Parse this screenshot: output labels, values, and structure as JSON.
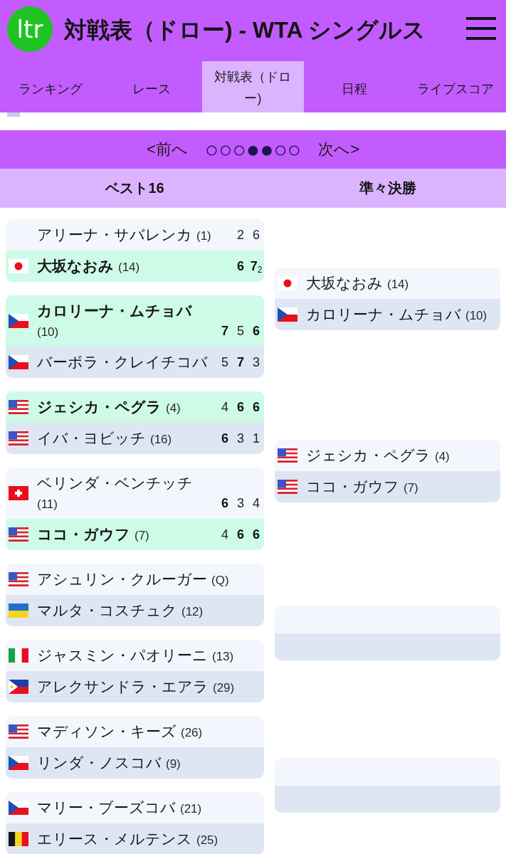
{
  "header": {
    "logo": "ltr",
    "title": "対戦表（ドロー) - WTA シングルス"
  },
  "tabs": [
    {
      "label": "ランキング",
      "selected": false
    },
    {
      "label": "レース",
      "selected": false
    },
    {
      "label": "対戦表（ドロー)",
      "selected": true
    },
    {
      "label": "日程",
      "selected": false
    },
    {
      "label": "ライブスコア",
      "selected": false
    }
  ],
  "pager": {
    "prev": "<前へ",
    "dots": "○○○●●○○",
    "next": "次へ>"
  },
  "rounds": [
    {
      "title": "ベスト16",
      "matches": [
        {
          "kind": "match",
          "players": [
            {
              "name": "アリーナ・サバレンカ",
              "seed": "(1)",
              "winner": false,
              "scores": [
                {
                  "games": "2",
                  "won": false
                },
                {
                  "games": "6",
                  "won": false
                }
              ]
            },
            {
              "flag": {
                "kind": "jp"
              },
              "name": "大坂なおみ",
              "seed": "(14)",
              "winner": true,
              "scores": [
                {
                  "games": "6",
                  "won": true
                },
                {
                  "games": "7",
                  "won": true,
                  "tiebreak": "2"
                }
              ]
            }
          ]
        },
        {
          "kind": "match",
          "players": [
            {
              "flag": {
                "kind": "cz"
              },
              "name": "カロリーナ・ムチョバ",
              "seed": "(10)",
              "winner": true,
              "scores": [
                {
                  "games": "7",
                  "won": true
                },
                {
                  "games": "5",
                  "won": false
                },
                {
                  "games": "6",
                  "won": true
                }
              ]
            },
            {
              "flag": {
                "kind": "cz"
              },
              "name": "バーボラ・クレイチコバ",
              "winner": false,
              "scores": [
                {
                  "games": "5",
                  "won": false
                },
                {
                  "games": "7",
                  "won": true
                },
                {
                  "games": "3",
                  "won": false
                }
              ]
            }
          ]
        },
        {
          "kind": "match",
          "players": [
            {
              "flag": {
                "kind": "us"
              },
              "name": "ジェシカ・ペグラ",
              "seed": "(4)",
              "winner": true,
              "scores": [
                {
                  "games": "4",
                  "won": false
                },
                {
                  "games": "6",
                  "won": true
                },
                {
                  "games": "6",
                  "won": true
                }
              ]
            },
            {
              "flag": {
                "kind": "us"
              },
              "name": "イバ・ヨビッチ",
              "seed": "(16)",
              "winner": false,
              "scores": [
                {
                  "games": "6",
                  "won": true
                },
                {
                  "games": "3",
                  "won": false
                },
                {
                  "games": "1",
                  "won": false
                }
              ]
            }
          ]
        },
        {
          "kind": "match",
          "players": [
            {
              "flag": {
                "kind": "ch"
              },
              "name": "ベリンダ・ベンチッチ",
              "seed": "(11)",
              "winner": false,
              "scores": [
                {
                  "games": "6",
                  "won": true
                },
                {
                  "games": "3",
                  "won": false
                },
                {
                  "games": "4",
                  "won": false
                }
              ]
            },
            {
              "flag": {
                "kind": "us"
              },
              "name": "ココ・ガウフ",
              "seed": "(7)",
              "winner": true,
              "scores": [
                {
                  "games": "4",
                  "won": false
                },
                {
                  "games": "6",
                  "won": true
                },
                {
                  "games": "6",
                  "won": true
                }
              ]
            }
          ]
        },
        {
          "kind": "match",
          "players": [
            {
              "flag": {
                "kind": "us"
              },
              "name": "アシュリン・クルーガー",
              "seed": "(Q)",
              "winner": false
            },
            {
              "flag": {
                "kind": "ua"
              },
              "name": "マルタ・コスチュク",
              "seed": "(12)",
              "winner": false
            }
          ]
        },
        {
          "kind": "match",
          "players": [
            {
              "flag": {
                "kind": "it"
              },
              "name": "ジャスミン・パオリーニ",
              "seed": "(13)",
              "winner": false
            },
            {
              "flag": {
                "kind": "ph"
              },
              "name": "アレクサンドラ・エアラ",
              "seed": "(29)",
              "winner": false
            }
          ]
        },
        {
          "kind": "match",
          "players": [
            {
              "flag": {
                "kind": "us"
              },
              "name": "マディソン・キーズ",
              "seed": "(26)",
              "winner": false
            },
            {
              "flag": {
                "kind": "cz"
              },
              "name": "リンダ・ノスコバ",
              "seed": "(9)",
              "winner": false
            }
          ]
        },
        {
          "kind": "match",
          "players": [
            {
              "flag": {
                "kind": "cz"
              },
              "name": "マリー・ブーズコバ",
              "seed": "(21)",
              "winner": false
            },
            {
              "flag": {
                "kind": "be"
              },
              "name": "エリース・メルテンス",
              "seed": "(25)",
              "winner": false
            }
          ]
        }
      ]
    },
    {
      "title": "準々決勝",
      "matches": [
        {
          "kind": "match",
          "players": [
            {
              "flag": {
                "kind": "jp"
              },
              "name": "大坂なおみ",
              "seed": "(14)",
              "winner": false
            },
            {
              "flag": {
                "kind": "cz"
              },
              "name": "カロリーナ・ムチョバ",
              "seed": "(10)",
              "winner": false
            }
          ]
        },
        {
          "kind": "match",
          "players": [
            {
              "flag": {
                "kind": "us"
              },
              "name": "ジェシカ・ペグラ",
              "seed": "(4)",
              "winner": false
            },
            {
              "flag": {
                "kind": "us"
              },
              "name": "ココ・ガウフ",
              "seed": "(7)",
              "winner": false
            }
          ]
        },
        {
          "kind": "tbd"
        },
        {
          "kind": "tbd"
        }
      ]
    }
  ]
}
